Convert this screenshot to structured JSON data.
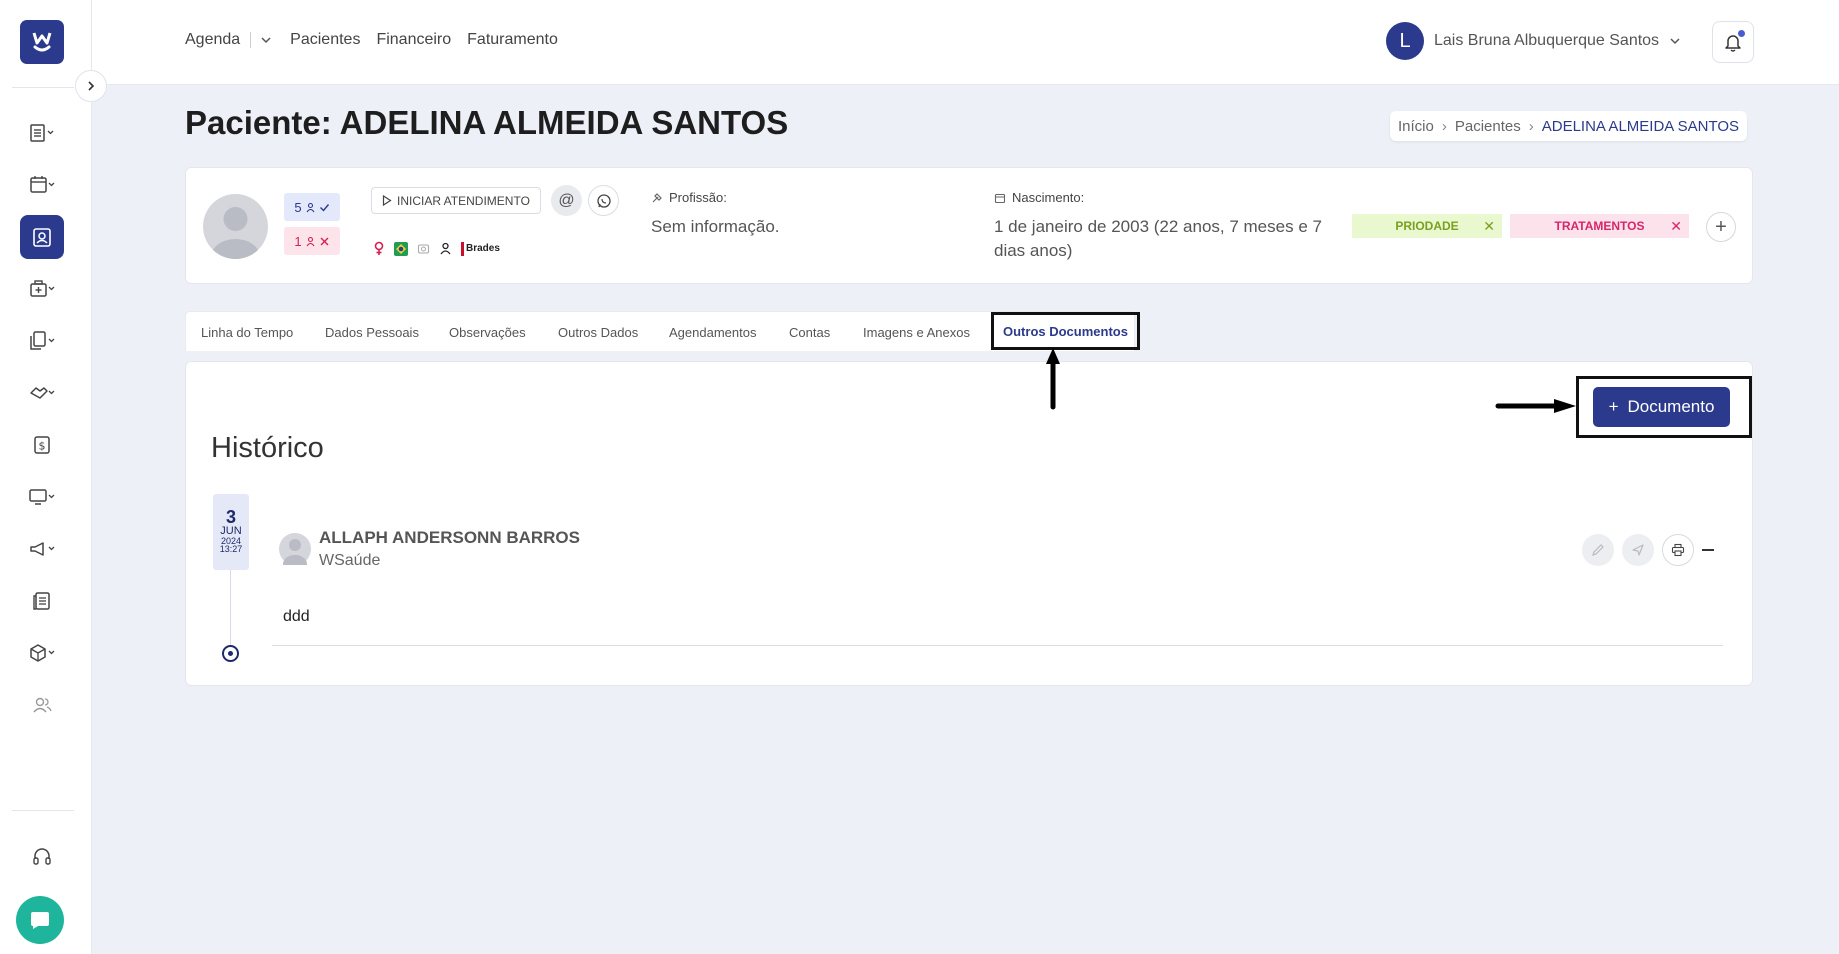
{
  "colors": {
    "primary": "#2b3a8c",
    "chat": "#1fb59d",
    "tag_prio_bg": "#e9f8cf",
    "tag_trat_bg": "#fce2ea"
  },
  "sidebar": {
    "logo": "W",
    "items": [
      {
        "icon": "list-icon"
      },
      {
        "icon": "calendar-icon"
      },
      {
        "icon": "patient-card-icon",
        "active": true
      },
      {
        "icon": "medical-bag-icon"
      },
      {
        "icon": "documents-icon"
      },
      {
        "icon": "handshake-icon"
      },
      {
        "icon": "dollar-icon"
      },
      {
        "icon": "monitor-icon"
      },
      {
        "icon": "megaphone-icon"
      },
      {
        "icon": "newspaper-icon"
      },
      {
        "icon": "package-icon"
      },
      {
        "icon": "users-icon"
      },
      {
        "icon": "headset-icon"
      }
    ]
  },
  "topnav": {
    "agenda": "Agenda",
    "pacientes": "Pacientes",
    "financeiro": "Financeiro",
    "faturamento": "Faturamento"
  },
  "user": {
    "initial": "L",
    "name": "Lais Bruna Albuquerque Santos"
  },
  "page": {
    "title": "Paciente: ADELINA ALMEIDA SANTOS"
  },
  "breadcrumb": {
    "home": "Início",
    "section": "Pacientes",
    "current": "ADELINA ALMEIDA SANTOS"
  },
  "patient": {
    "attended_count": "5",
    "missed_count": "1",
    "start_button": "INICIAR ATENDIMENTO",
    "insurance": "Brades",
    "profession_label": "Profissão:",
    "profession_value": "Sem informação.",
    "birth_label": "Nascimento:",
    "birth_value": "1 de janeiro de 2003 (22 anos, 7 meses e 7 dias anos)",
    "tags": [
      {
        "label": "PRIODADE"
      },
      {
        "label": "TRATAMENTOS"
      }
    ]
  },
  "tabs": [
    "Linha do Tempo",
    "Dados Pessoais",
    "Observações",
    "Outros Dados",
    "Agendamentos",
    "Contas",
    "Imagens e Anexos",
    "Outros Documentos"
  ],
  "content": {
    "add_button": "Documento",
    "history_title": "Histórico",
    "entry": {
      "day": "3",
      "month": "JUN",
      "year": "2024",
      "time": "13:27",
      "author": "ALLAPH ANDERSONN BARROS",
      "org": "WSaúde",
      "text": "ddd"
    }
  }
}
